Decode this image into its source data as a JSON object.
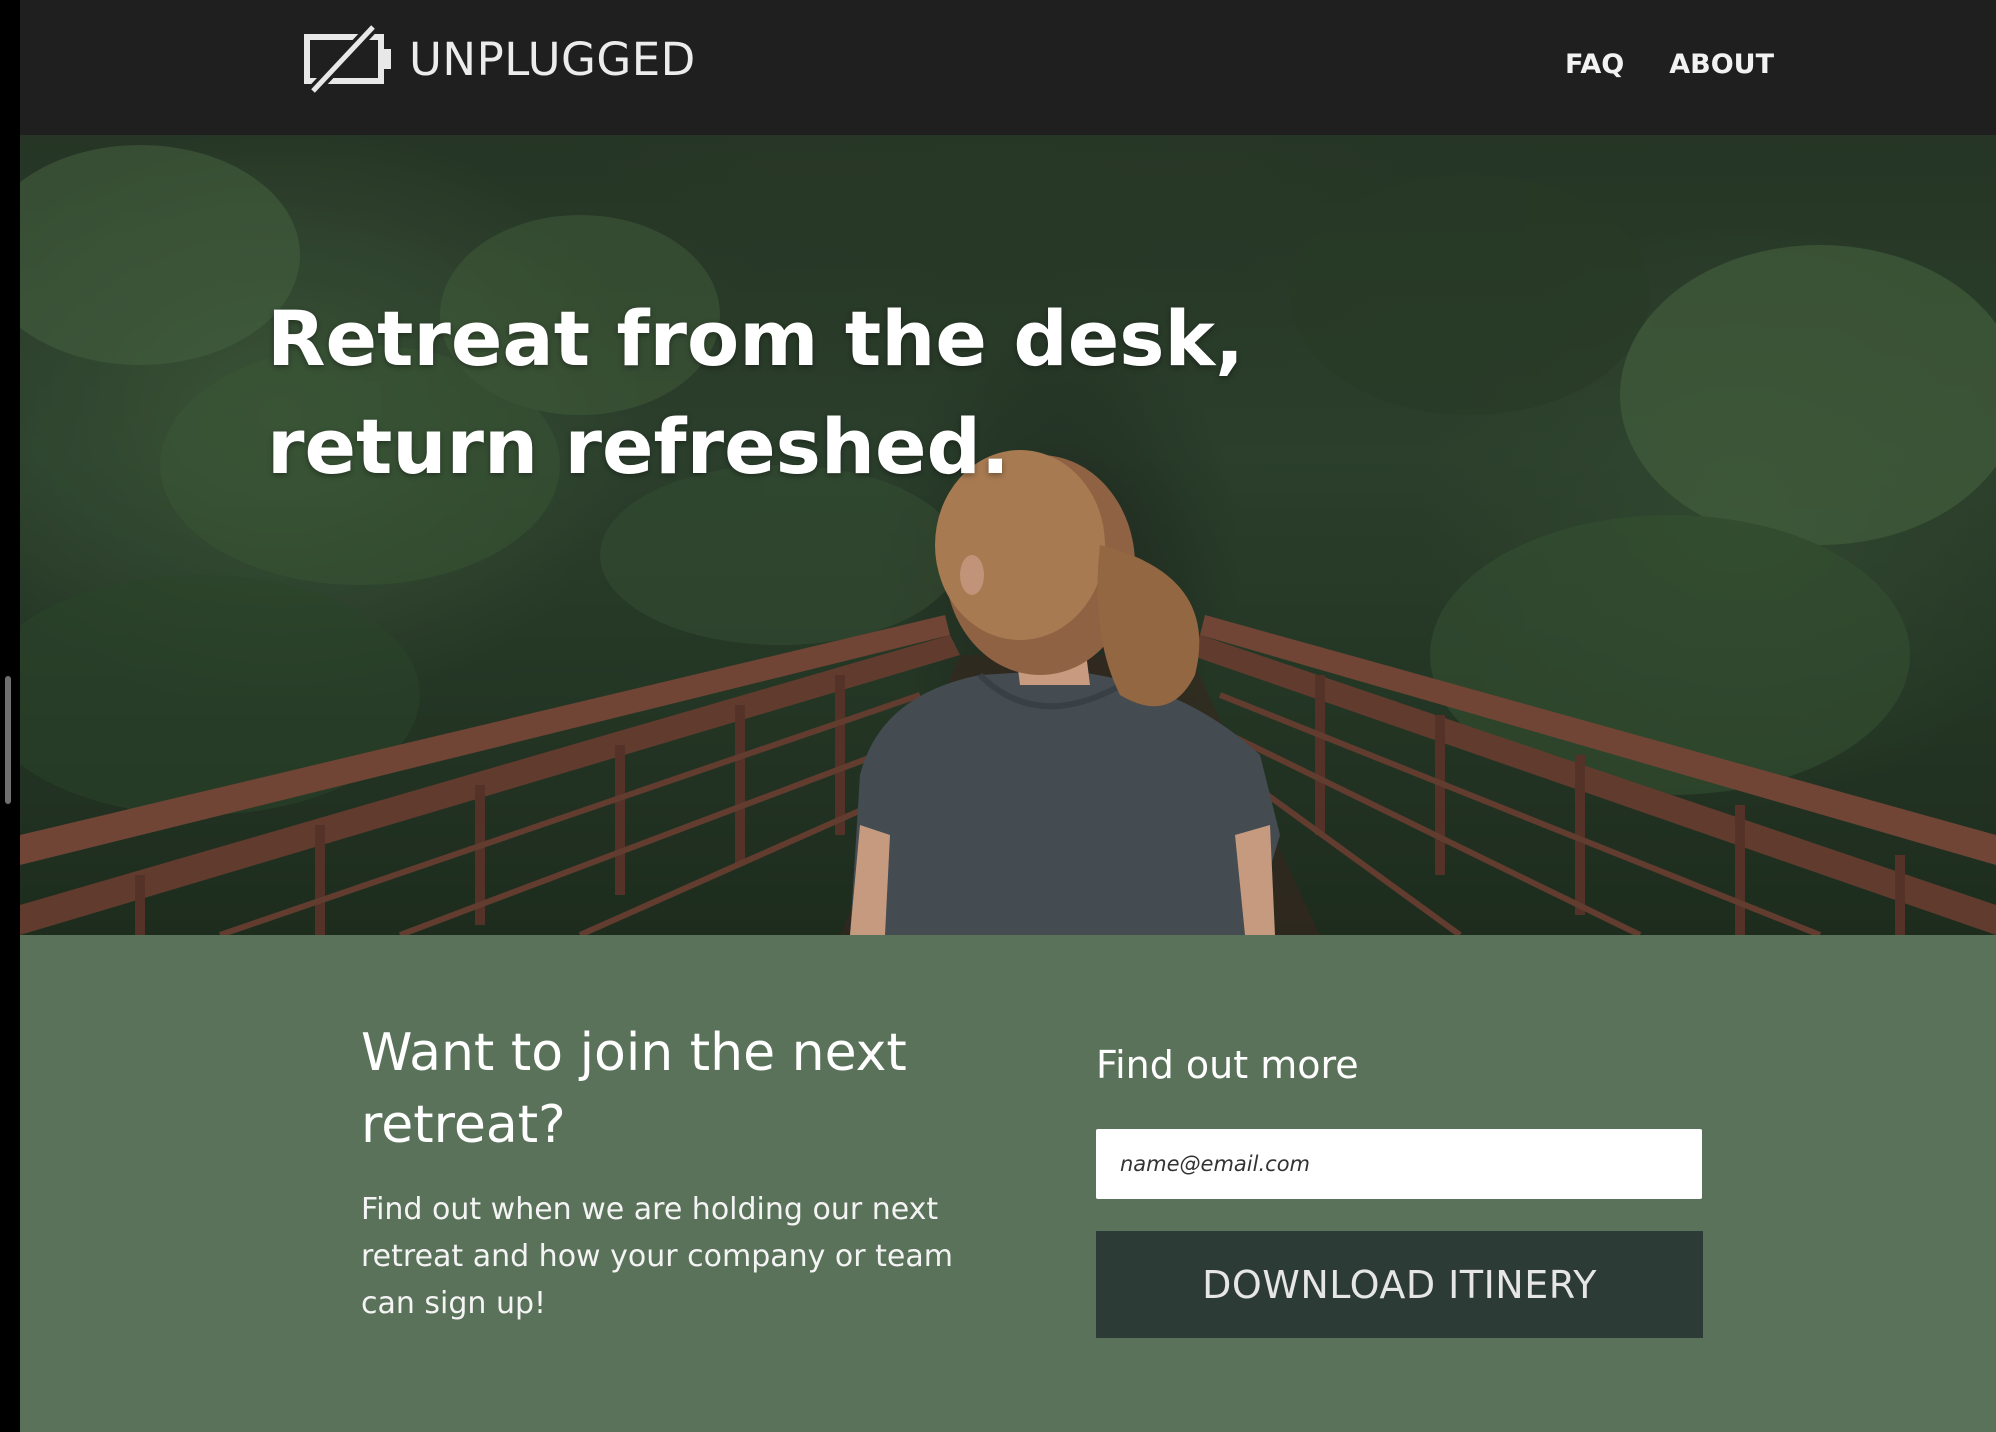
{
  "brand": {
    "name": "UNPLUGGED",
    "icon": "unplugged-battery-icon"
  },
  "nav": {
    "items": [
      {
        "label": "FAQ"
      },
      {
        "label": "ABOUT"
      }
    ]
  },
  "hero": {
    "title": "Retreat from the desk, return refreshed."
  },
  "signup": {
    "heading": "Want to join the next retreat?",
    "text": "Find out when we are holding our next retreat and how your company or team can sign up!",
    "form_title": "Find out more",
    "email_placeholder": "name@email.com",
    "button_label": "DOWNLOAD ITINERY"
  },
  "colors": {
    "header_bg": "#1f1f1f",
    "signup_bg": "#5a725a",
    "button_bg": "#2d3b36"
  }
}
